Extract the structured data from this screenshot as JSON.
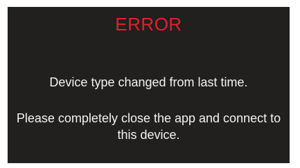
{
  "dialog": {
    "title": "ERROR",
    "message_line": "Device type changed from last time.",
    "instruction": "Please completely close the app and connect to this device."
  },
  "colors": {
    "background": "#221f1f",
    "title": "#e5202a",
    "text": "#f3f3f3"
  }
}
